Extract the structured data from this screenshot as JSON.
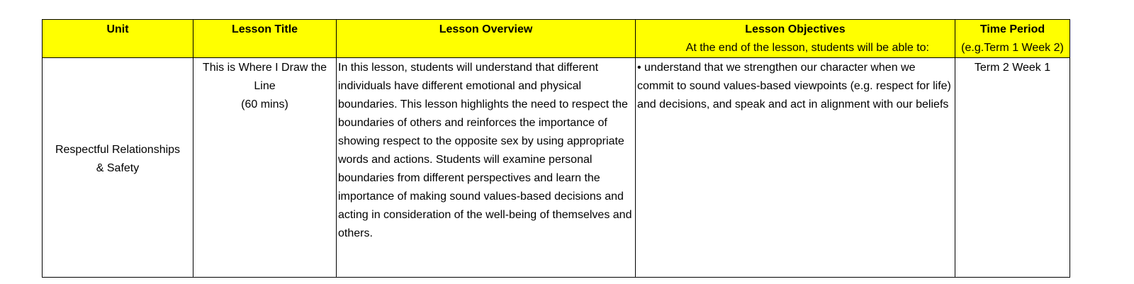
{
  "headers": {
    "unit": "Unit",
    "lesson_title": "Lesson Title",
    "lesson_overview": "Lesson Overview",
    "lesson_objectives": "Lesson Objectives",
    "lesson_objectives_sub": "At the end of the lesson, students will be able to:",
    "time_period": "Time Period",
    "time_period_sub": "(e.g.Term 1 Week 2)"
  },
  "row": {
    "unit_line1": "Respectful Relationships",
    "unit_line2": "& Safety",
    "title_line1": "This is Where I Draw the",
    "title_line2": "Line",
    "duration": "(60 mins)",
    "overview": "In this lesson, students will understand that different individuals have different emotional and physical boundaries. This lesson highlights the need to respect the boundaries of others and reinforces the importance of showing respect to the opposite sex by using appropriate words and actions. Students will examine personal boundaries from different perspectives and learn the importance of making sound values-based decisions and acting in consideration of the well-being of themselves and others.",
    "objective_1": "• understand that we strengthen our character when we commit to sound values-based viewpoints (e.g. respect for life) and decisions, and speak and act in alignment with our beliefs",
    "time_period": "Term 2 Week 1"
  },
  "colors": {
    "header_background": "#ffff00",
    "border": "#000000"
  }
}
